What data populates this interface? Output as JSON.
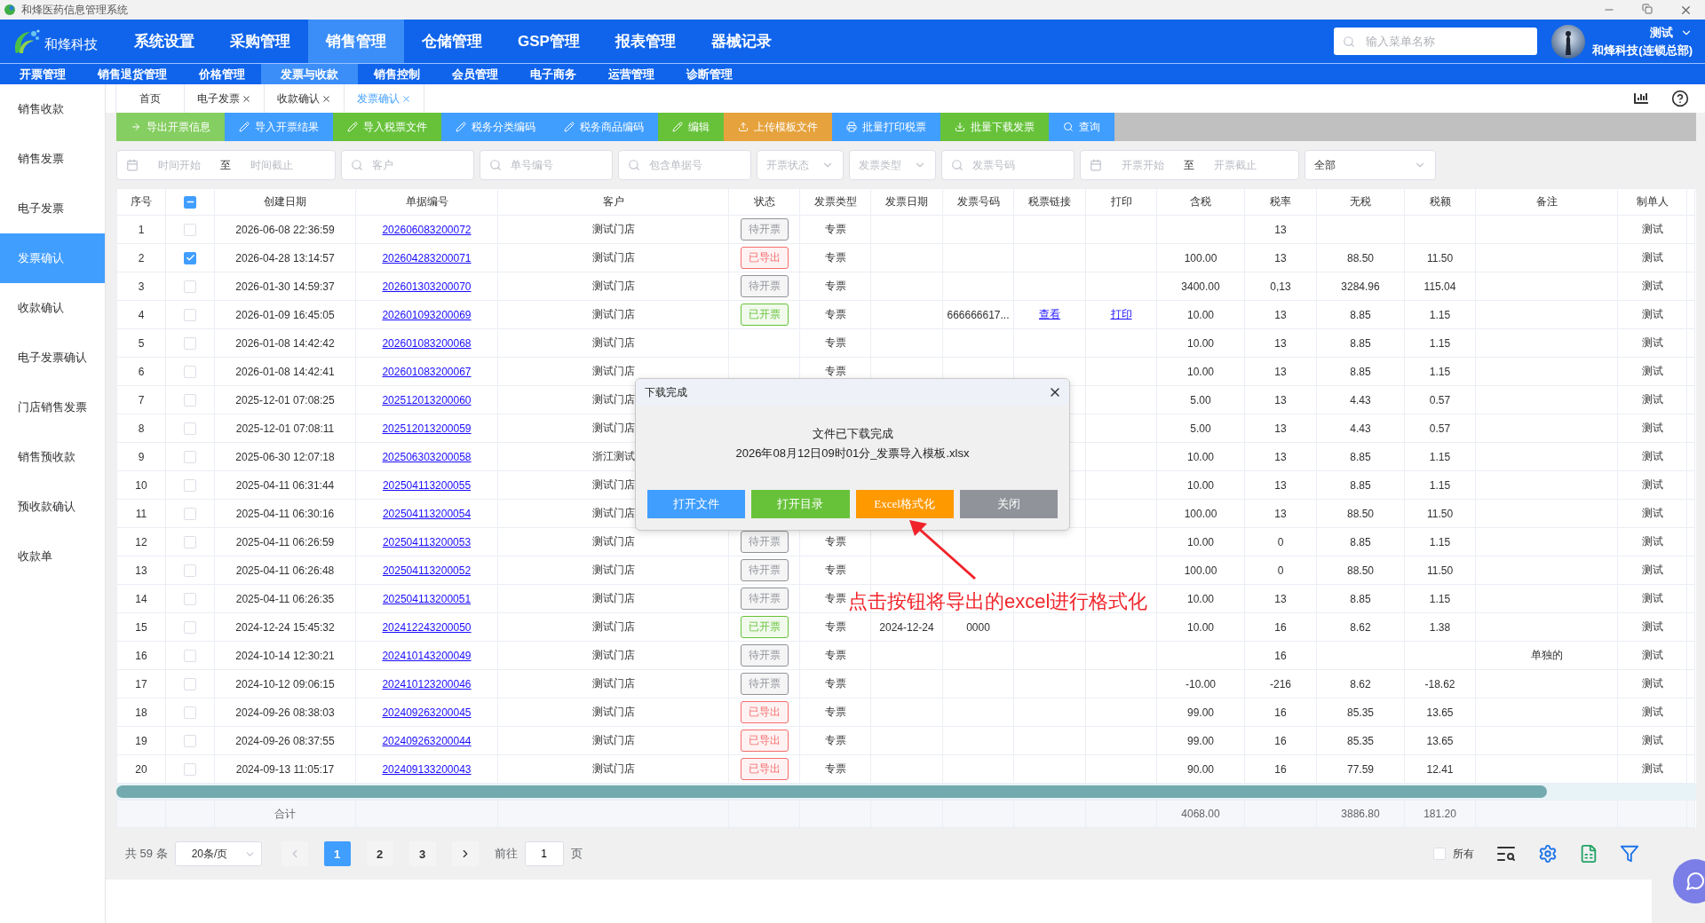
{
  "window": {
    "title": "和烽医药信息管理系统"
  },
  "brand": {
    "name": "和烽科技"
  },
  "main_menu": [
    {
      "label": "系统设置",
      "selected": false
    },
    {
      "label": "采购管理",
      "selected": false
    },
    {
      "label": "销售管理",
      "selected": true
    },
    {
      "label": "仓储管理",
      "selected": false
    },
    {
      "label": "GSP管理",
      "selected": false
    },
    {
      "label": "报表管理",
      "selected": false
    },
    {
      "label": "器械记录",
      "selected": false
    }
  ],
  "menu_search": {
    "placeholder": "输入菜单名称"
  },
  "user": {
    "name": "测试",
    "org": "和烽科技(连锁总部)"
  },
  "sub_menu": [
    {
      "label": "开票管理",
      "selected": false
    },
    {
      "label": "销售退货管理",
      "selected": false
    },
    {
      "label": "价格管理",
      "selected": false
    },
    {
      "label": "发票与收款",
      "selected": true
    },
    {
      "label": "销售控制",
      "selected": false
    },
    {
      "label": "会员管理",
      "selected": false
    },
    {
      "label": "电子商务",
      "selected": false
    },
    {
      "label": "运营管理",
      "selected": false
    },
    {
      "label": "诊断管理",
      "selected": false
    }
  ],
  "sidebar": {
    "items": [
      {
        "label": "销售收款",
        "selected": false
      },
      {
        "label": "销售发票",
        "selected": false
      },
      {
        "label": "电子发票",
        "selected": false
      },
      {
        "label": "发票确认",
        "selected": true
      },
      {
        "label": "收款确认",
        "selected": false
      },
      {
        "label": "电子发票确认",
        "selected": false
      },
      {
        "label": "门店销售发票",
        "selected": false
      },
      {
        "label": "销售预收款",
        "selected": false
      },
      {
        "label": "预收款确认",
        "selected": false
      },
      {
        "label": "收款单",
        "selected": false
      }
    ]
  },
  "tabs": [
    {
      "label": "首页",
      "closable": false,
      "selected": false
    },
    {
      "label": "电子发票",
      "closable": true,
      "selected": false
    },
    {
      "label": "收款确认",
      "closable": true,
      "selected": false
    },
    {
      "label": "发票确认",
      "closable": true,
      "selected": true
    }
  ],
  "toolbar": [
    {
      "label": "导出开票信息",
      "kind": "export",
      "color": "#85ce61"
    },
    {
      "label": "导入开票结果",
      "kind": "edit",
      "color": "#409eff"
    },
    {
      "label": "导入税票文件",
      "kind": "edit",
      "color": "#67c23a"
    },
    {
      "label": "税务分类编码",
      "kind": "edit",
      "color": "#409eff"
    },
    {
      "label": "税务商品编码",
      "kind": "edit",
      "color": "#409eff"
    },
    {
      "label": "编辑",
      "kind": "edit",
      "color": "#67c23a"
    },
    {
      "label": "上传模板文件",
      "kind": "upload",
      "color": "#e6a23c"
    },
    {
      "label": "批量打印税票",
      "kind": "print",
      "color": "#409eff"
    },
    {
      "label": "批量下载发票",
      "kind": "download",
      "color": "#67c23a"
    },
    {
      "label": "查询",
      "kind": "search",
      "color": "#409eff"
    }
  ],
  "filters": [
    {
      "kind": "daterange",
      "start_placeholder": "时间开始",
      "separator": "至",
      "end_placeholder": "时间截止"
    },
    {
      "kind": "search",
      "placeholder": "客户"
    },
    {
      "kind": "search",
      "placeholder": "单号编号"
    },
    {
      "kind": "search",
      "placeholder": "包含单据号"
    },
    {
      "kind": "select",
      "placeholder": "开票状态"
    },
    {
      "kind": "select",
      "placeholder": "发票类型"
    },
    {
      "kind": "search",
      "placeholder": "发票号码"
    },
    {
      "kind": "daterange",
      "start_placeholder": "开票开始",
      "separator": "至",
      "end_placeholder": "开票截止"
    },
    {
      "kind": "select",
      "value": "全部"
    }
  ],
  "table": {
    "columns": [
      "序号",
      "创建日期",
      "单据编号",
      "客户",
      "状态",
      "发票类型",
      "发票日期",
      "发票号码",
      "税票链接",
      "打印",
      "含税",
      "税率",
      "无税",
      "税额",
      "备注",
      "制单人"
    ],
    "header_checkbox": {
      "indeterminate": true
    },
    "rows": [
      {
        "no": "1",
        "checked": false,
        "created": "2026-06-08 22:36:59",
        "doc_no": "202606083200072",
        "customer": "测试门店",
        "status": "待开票",
        "color": "#909399",
        "invoice_type": "专票",
        "tax_rate": "13",
        "maker": "测试"
      },
      {
        "no": "2",
        "checked": true,
        "created": "2026-04-28 13:14:57",
        "doc_no": "202604283200071",
        "customer": "测试门店",
        "status": "已导出",
        "color": "#f56c6c",
        "invoice_type": "专票",
        "incl_tax": "100.00",
        "tax_rate": "13",
        "excl_tax": "88.50",
        "tax_amount": "11.50",
        "maker": "测试"
      },
      {
        "no": "3",
        "checked": false,
        "created": "2026-01-30 14:59:37",
        "doc_no": "202601303200070",
        "customer": "测试门店",
        "status": "待开票",
        "color": "#909399",
        "invoice_type": "专票",
        "incl_tax": "3400.00",
        "tax_rate": "0,13",
        "excl_tax": "3284.96",
        "tax_amount": "115.04",
        "maker": "测试"
      },
      {
        "no": "4",
        "checked": false,
        "created": "2026-01-09 16:45:05",
        "doc_no": "202601093200069",
        "customer": "测试门店",
        "status": "已开票",
        "color": "#67c23a",
        "invoice_type": "专票",
        "invoice_no": "666666617...",
        "tax_link": "查看",
        "print": "打印",
        "incl_tax": "10.00",
        "tax_rate": "13",
        "excl_tax": "8.85",
        "tax_amount": "1.15",
        "maker": "测试"
      },
      {
        "no": "5",
        "checked": false,
        "created": "2026-01-08 14:42:42",
        "doc_no": "202601083200068",
        "customer": "测试门店",
        "invoice_type": "专票",
        "incl_tax": "10.00",
        "tax_rate": "13",
        "excl_tax": "8.85",
        "tax_amount": "1.15",
        "maker": "测试"
      },
      {
        "no": "6",
        "checked": false,
        "created": "2026-01-08 14:42:41",
        "doc_no": "202601083200067",
        "customer": "测试门店",
        "invoice_type": "专票",
        "incl_tax": "10.00",
        "tax_rate": "13",
        "excl_tax": "8.85",
        "tax_amount": "1.15",
        "maker": "测试"
      },
      {
        "no": "7",
        "checked": false,
        "created": "2025-12-01 07:08:25",
        "doc_no": "202512013200060",
        "customer": "测试门店",
        "incl_tax": "5.00",
        "tax_rate": "13",
        "excl_tax": "4.43",
        "tax_amount": "0.57",
        "maker": "测试"
      },
      {
        "no": "8",
        "checked": false,
        "created": "2025-12-01 07:08:11",
        "doc_no": "202512013200059",
        "customer": "测试门店",
        "incl_tax": "5.00",
        "tax_rate": "13",
        "excl_tax": "4.43",
        "tax_amount": "0.57",
        "maker": "测试"
      },
      {
        "no": "9",
        "checked": false,
        "created": "2025-06-30 12:07:18",
        "doc_no": "202506303200058",
        "customer": "浙江测试",
        "incl_tax": "10.00",
        "tax_rate": "13",
        "excl_tax": "8.85",
        "tax_amount": "1.15",
        "maker": "测试"
      },
      {
        "no": "10",
        "checked": false,
        "created": "2025-04-11 06:31:44",
        "doc_no": "202504113200055",
        "customer": "测试门店",
        "incl_tax": "10.00",
        "tax_rate": "13",
        "excl_tax": "8.85",
        "tax_amount": "1.15",
        "maker": "测试"
      },
      {
        "no": "11",
        "checked": false,
        "created": "2025-04-11 06:30:16",
        "doc_no": "202504113200054",
        "customer": "测试门店",
        "incl_tax": "100.00",
        "tax_rate": "13",
        "excl_tax": "88.50",
        "tax_amount": "11.50",
        "maker": "测试"
      },
      {
        "no": "12",
        "checked": false,
        "created": "2025-04-11 06:26:59",
        "doc_no": "202504113200053",
        "customer": "测试门店",
        "status": "待开票",
        "color": "#909399",
        "invoice_type": "专票",
        "incl_tax": "10.00",
        "tax_rate": "0",
        "excl_tax": "8.85",
        "tax_amount": "1.15",
        "maker": "测试"
      },
      {
        "no": "13",
        "checked": false,
        "created": "2025-04-11 06:26:48",
        "doc_no": "202504113200052",
        "customer": "测试门店",
        "status": "待开票",
        "color": "#909399",
        "invoice_type": "专票",
        "incl_tax": "100.00",
        "tax_rate": "0",
        "excl_tax": "88.50",
        "tax_amount": "11.50",
        "maker": "测试"
      },
      {
        "no": "14",
        "checked": false,
        "created": "2025-04-11 06:26:35",
        "doc_no": "202504113200051",
        "customer": "测试门店",
        "status": "待开票",
        "color": "#909399",
        "invoice_type": "专票",
        "incl_tax": "10.00",
        "tax_rate": "13",
        "excl_tax": "8.85",
        "tax_amount": "1.15",
        "maker": "测试"
      },
      {
        "no": "15",
        "checked": false,
        "created": "2024-12-24 15:45:32",
        "doc_no": "202412243200050",
        "customer": "测试门店",
        "status": "已开票",
        "color": "#67c23a",
        "invoice_type": "专票",
        "invoice_date": "2024-12-24",
        "invoice_no": "0000",
        "incl_tax": "10.00",
        "tax_rate": "16",
        "excl_tax": "8.62",
        "tax_amount": "1.38",
        "maker": "测试"
      },
      {
        "no": "16",
        "checked": false,
        "created": "2024-10-14 12:30:21",
        "doc_no": "202410143200049",
        "customer": "测试门店",
        "status": "待开票",
        "color": "#909399",
        "invoice_type": "专票",
        "tax_rate": "16",
        "remark": "单独的",
        "maker": "测试"
      },
      {
        "no": "17",
        "checked": false,
        "created": "2024-10-12 09:06:15",
        "doc_no": "202410123200046",
        "customer": "测试门店",
        "status": "待开票",
        "color": "#909399",
        "invoice_type": "专票",
        "incl_tax": "-10.00",
        "tax_rate": "-216",
        "excl_tax": "8.62",
        "tax_amount": "-18.62",
        "maker": "测试"
      },
      {
        "no": "18",
        "checked": false,
        "created": "2024-09-26 08:38:03",
        "doc_no": "202409263200045",
        "customer": "测试门店",
        "status": "已导出",
        "color": "#f56c6c",
        "invoice_type": "专票",
        "incl_tax": "99.00",
        "tax_rate": "16",
        "excl_tax": "85.35",
        "tax_amount": "13.65",
        "maker": "测试"
      },
      {
        "no": "19",
        "checked": false,
        "created": "2024-09-26 08:37:55",
        "doc_no": "202409263200044",
        "customer": "测试门店",
        "status": "已导出",
        "color": "#f56c6c",
        "invoice_type": "专票",
        "incl_tax": "99.00",
        "tax_rate": "16",
        "excl_tax": "85.35",
        "tax_amount": "13.65",
        "maker": "测试"
      },
      {
        "no": "20",
        "checked": false,
        "created": "2024-09-13 11:05:17",
        "doc_no": "202409133200043",
        "customer": "测试门店",
        "status": "已导出",
        "color": "#f56c6c",
        "invoice_type": "专票",
        "incl_tax": "90.00",
        "tax_rate": "16",
        "excl_tax": "77.59",
        "tax_amount": "12.41",
        "maker": "测试"
      }
    ],
    "totals": {
      "label": "合计",
      "incl_tax": "4068.00",
      "excl_tax": "3886.80",
      "tax_amount": "181.20"
    }
  },
  "pagination": {
    "total": "共 59 条",
    "page_size": "20条/页",
    "pages": [
      {
        "label": "1",
        "selected": true
      },
      {
        "label": "2",
        "selected": false
      },
      {
        "label": "3",
        "selected": false
      }
    ],
    "goto_label": "前往",
    "goto_value": "1",
    "page_unit": "页"
  },
  "footer_options": {
    "all_label": "所有",
    "all_checked": false
  },
  "dialog": {
    "title": "下载完成",
    "message": "文件已下载完成",
    "file": "2026年08月12日09时01分_发票导入模板.xlsx",
    "buttons": [
      {
        "label": "打开文件",
        "color": "#409eff"
      },
      {
        "label": "打开目录",
        "color": "#67c23a"
      },
      {
        "label": "Excel格式化",
        "color": "#ff9900"
      },
      {
        "label": "关闭",
        "color": "#909399"
      }
    ]
  },
  "annotation": {
    "text": "点击按钮将导出的excel进行格式化"
  }
}
